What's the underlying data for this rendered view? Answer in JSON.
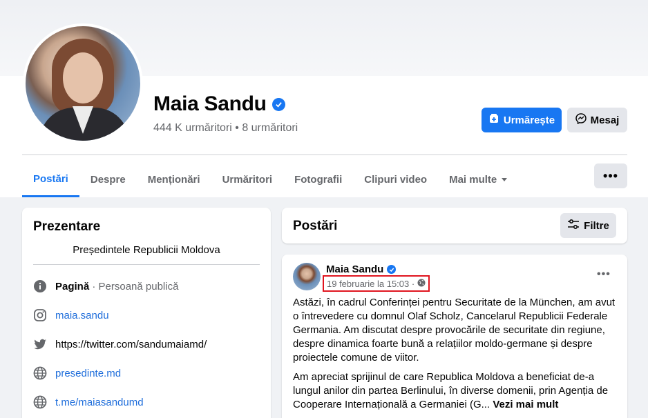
{
  "profile": {
    "name": "Maia Sandu",
    "followers": "444 K urmăritori • 8 urmăritori",
    "follow_label": "Urmărește",
    "message_label": "Mesaj"
  },
  "tabs": [
    {
      "label": "Postări",
      "active": true
    },
    {
      "label": "Despre"
    },
    {
      "label": "Menționări"
    },
    {
      "label": "Urmăritori"
    },
    {
      "label": "Fotografii"
    },
    {
      "label": "Clipuri video"
    },
    {
      "label": "Mai multe"
    }
  ],
  "intro": {
    "title": "Prezentare",
    "bio": "Președintele Republicii Moldova",
    "page_label": "Pagină",
    "page_category": " · Persoană publică",
    "instagram": "maia.sandu",
    "twitter": "https://twitter.com/sandumaiamd/",
    "website": "presedinte.md",
    "telegram": "t.me/maiasandumd"
  },
  "posts": {
    "title": "Postări",
    "filter_label": "Filtre"
  },
  "post": {
    "author": "Maia Sandu",
    "time": "19 februarie la 15:03 ·",
    "paragraph1": "Astăzi, în cadrul Conferinței pentru Securitate de la München, am avut o întrevedere cu domnul Olaf Scholz, Cancelarul Republicii Federale Germania. Am discutat despre provocările de securitate din regiune, despre dinamica foarte bună a relațiilor moldo-germane și despre proiectele comune de viitor.",
    "paragraph2": "Am apreciat sprijinul de care Republica Moldova a beneficiat de-a lungul anilor din partea Berlinului, în diverse domenii, prin Agenția de Cooperare Internațională a Germaniei (G...",
    "see_more": "Vezi mai mult"
  },
  "colors": {
    "accent": "#1877f2",
    "highlight_box": "#e0141e"
  }
}
